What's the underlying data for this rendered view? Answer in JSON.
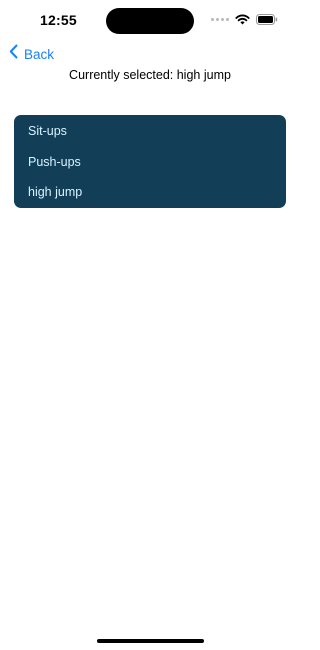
{
  "status_bar": {
    "time": "12:55",
    "icons": [
      "signal-dots-icon",
      "wifi-icon",
      "battery-icon"
    ]
  },
  "nav": {
    "back_label": "Back",
    "back_icon": "chevron-left-icon"
  },
  "selection": {
    "text": "Currently selected: high jump"
  },
  "exercises": {
    "items": [
      {
        "label": "Sit-ups"
      },
      {
        "label": "Push-ups"
      },
      {
        "label": "high jump"
      }
    ]
  },
  "colors": {
    "accent": "#1a82f7",
    "card_background": "#123f57",
    "card_text": "#d9f3ff"
  }
}
